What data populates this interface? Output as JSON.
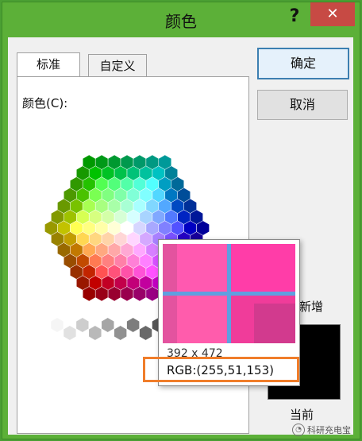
{
  "window": {
    "title": "颜色",
    "help_label": "?",
    "close_label": "✕"
  },
  "tabs": [
    {
      "label": "标准",
      "active": true
    },
    {
      "label": "自定义",
      "active": false
    }
  ],
  "colors_label": "颜色(C):",
  "buttons": {
    "ok": "确定",
    "cancel": "取消"
  },
  "preview": {
    "new_label": "新增",
    "current_label": "当前",
    "new_color": "#000000"
  },
  "magnifier": {
    "coords": "392 x 472",
    "rgb_text": "RGB:(255,51,153)",
    "sampled_color": "#ff3399"
  },
  "watermark": {
    "text": "科研充电宝",
    "icon": "wechat-icon"
  }
}
